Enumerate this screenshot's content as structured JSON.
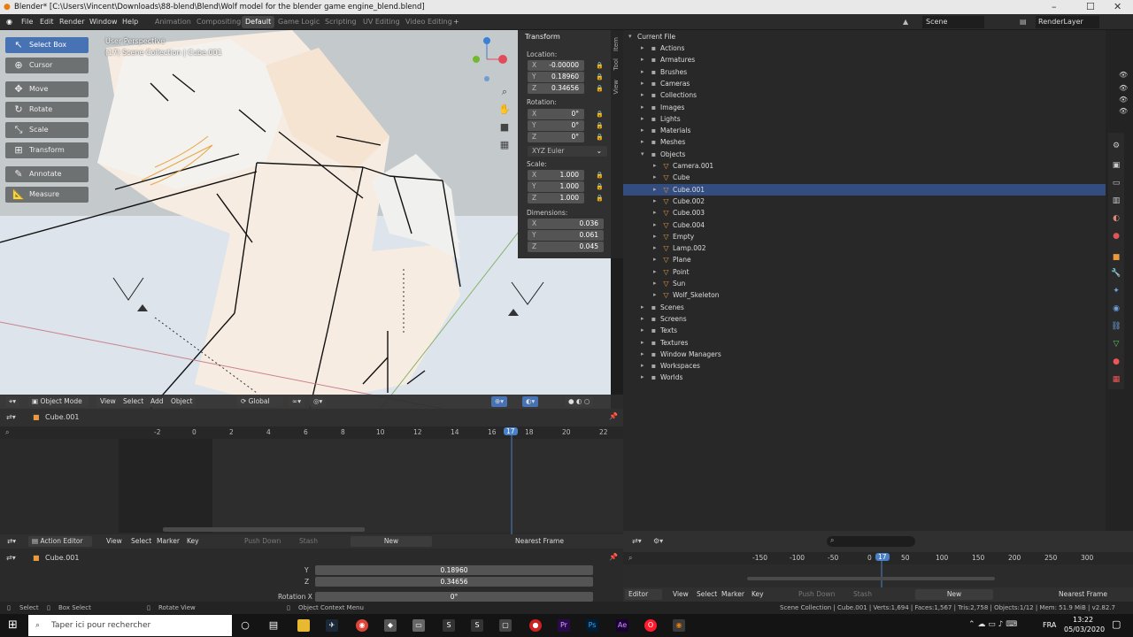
{
  "window": {
    "title": "Blender* [C:\\Users\\Vincent\\Downloads\\88-blend\\Blend\\Wolf model for the blender game engine_blend.blend]",
    "controls": [
      "–",
      "☐",
      "✕"
    ]
  },
  "menu": [
    "File",
    "Edit",
    "Render",
    "Window",
    "Help"
  ],
  "workspaces": [
    "Animation",
    "Compositing",
    "Default",
    "Game Logic",
    "Scripting",
    "UV Editing",
    "Video Editing"
  ],
  "active_workspace": "Default",
  "scene": "Scene",
  "renderlayer": "RenderLayer",
  "tools": [
    "Select Box",
    "Cursor",
    "Move",
    "Rotate",
    "Scale",
    "Transform",
    "Annotate",
    "Measure"
  ],
  "tool_icons": [
    "select-box-icon",
    "cursor-icon",
    "move-icon",
    "rotate-icon",
    "scale-icon",
    "transform-icon",
    "annotate-icon",
    "measure-icon"
  ],
  "viewport": {
    "perspective": "User Perspective",
    "collection": "(17) Scene Collection | Cube.001"
  },
  "npanel": {
    "title": "Transform",
    "location_label": "Location:",
    "location": [
      "-0.00000",
      "0.18960",
      "0.34656"
    ],
    "rotation_label": "Rotation:",
    "rotation": [
      "0°",
      "0°",
      "0°"
    ],
    "rotation_mode": "XYZ Euler",
    "scale_label": "Scale:",
    "scale": [
      "1.000",
      "1.000",
      "1.000"
    ],
    "dimensions_label": "Dimensions:",
    "dimensions": [
      "0.036",
      "0.061",
      "0.045"
    ],
    "axes": [
      "X",
      "Y",
      "Z"
    ],
    "tabs": [
      "Item",
      "Tool",
      "View"
    ]
  },
  "viewport_header": {
    "mode": "Object Mode",
    "menus": [
      "View",
      "Select",
      "Add",
      "Object"
    ],
    "orientation": "Global"
  },
  "outliner": {
    "root": "Current File",
    "items": [
      {
        "label": "Actions",
        "level": 1,
        "open": false
      },
      {
        "label": "Armatures",
        "level": 1,
        "open": false
      },
      {
        "label": "Brushes",
        "level": 1,
        "open": false
      },
      {
        "label": "Cameras",
        "level": 1,
        "open": false
      },
      {
        "label": "Collections",
        "level": 1,
        "open": false
      },
      {
        "label": "Images",
        "level": 1,
        "open": false
      },
      {
        "label": "Lights",
        "level": 1,
        "open": false
      },
      {
        "label": "Materials",
        "level": 1,
        "open": false
      },
      {
        "label": "Meshes",
        "level": 1,
        "open": false
      },
      {
        "label": "Objects",
        "level": 1,
        "open": true
      },
      {
        "label": "Camera.001",
        "level": 2,
        "open": false
      },
      {
        "label": "Cube",
        "level": 2,
        "open": false
      },
      {
        "label": "Cube.001",
        "level": 2,
        "open": false,
        "selected": true
      },
      {
        "label": "Cube.002",
        "level": 2,
        "open": false
      },
      {
        "label": "Cube.003",
        "level": 2,
        "open": false
      },
      {
        "label": "Cube.004",
        "level": 2,
        "open": false
      },
      {
        "label": "Empty",
        "level": 2,
        "open": false
      },
      {
        "label": "Lamp.002",
        "level": 2,
        "open": false
      },
      {
        "label": "Plane",
        "level": 2,
        "open": false
      },
      {
        "label": "Point",
        "level": 2,
        "open": false
      },
      {
        "label": "Sun",
        "level": 2,
        "open": false
      },
      {
        "label": "Wolf_Skeleton",
        "level": 2,
        "open": false
      },
      {
        "label": "Scenes",
        "level": 1,
        "open": false
      },
      {
        "label": "Screens",
        "level": 1,
        "open": false
      },
      {
        "label": "Texts",
        "level": 1,
        "open": false
      },
      {
        "label": "Textures",
        "level": 1,
        "open": false
      },
      {
        "label": "Window Managers",
        "level": 1,
        "open": false
      },
      {
        "label": "Workspaces",
        "level": 1,
        "open": false
      },
      {
        "label": "Worlds",
        "level": 1,
        "open": false
      }
    ]
  },
  "timeline": {
    "object": "Cube.001",
    "ticks": [
      "-2",
      "0",
      "2",
      "4",
      "6",
      "8",
      "10",
      "12",
      "14",
      "16",
      "17",
      "18",
      "20",
      "22"
    ],
    "current_frame": "17"
  },
  "action_editor": {
    "mode": "Action Editor",
    "menus": [
      "View",
      "Select",
      "Marker",
      "Key"
    ],
    "push_down": "Push Down",
    "stash": "Stash",
    "new": "New",
    "snap": "Nearest Frame"
  },
  "graph": {
    "object": "Cube.001",
    "rows": [
      {
        "label": "Y",
        "value": "0.18960"
      },
      {
        "label": "Z",
        "value": "0.34656"
      },
      {
        "label": "Rotation X",
        "value": "0°"
      }
    ]
  },
  "dope2": {
    "ticks": [
      "-150",
      "-100",
      "-50",
      "0",
      "17",
      "50",
      "100",
      "150",
      "200",
      "250",
      "300"
    ],
    "mode": "Editor",
    "menus": [
      "View",
      "Select",
      "Marker",
      "Key"
    ],
    "push_down": "Push Down",
    "stash": "Stash",
    "new": "New",
    "snap": "Nearest Frame"
  },
  "statusbar": {
    "left": [
      "Select",
      "Box Select",
      "Rotate View",
      "Object Context Menu"
    ],
    "right": "Scene Collection | Cube.001 | Verts:1,694 | Faces:1,567 | Tris:2,758 | Objects:1/12 | Mem: 51.9 MiB | v2.82.7"
  },
  "taskbar": {
    "search_placeholder": "Taper ici pour rechercher",
    "lang": "FRA",
    "time": "13:22",
    "date": "05/03/2020"
  }
}
